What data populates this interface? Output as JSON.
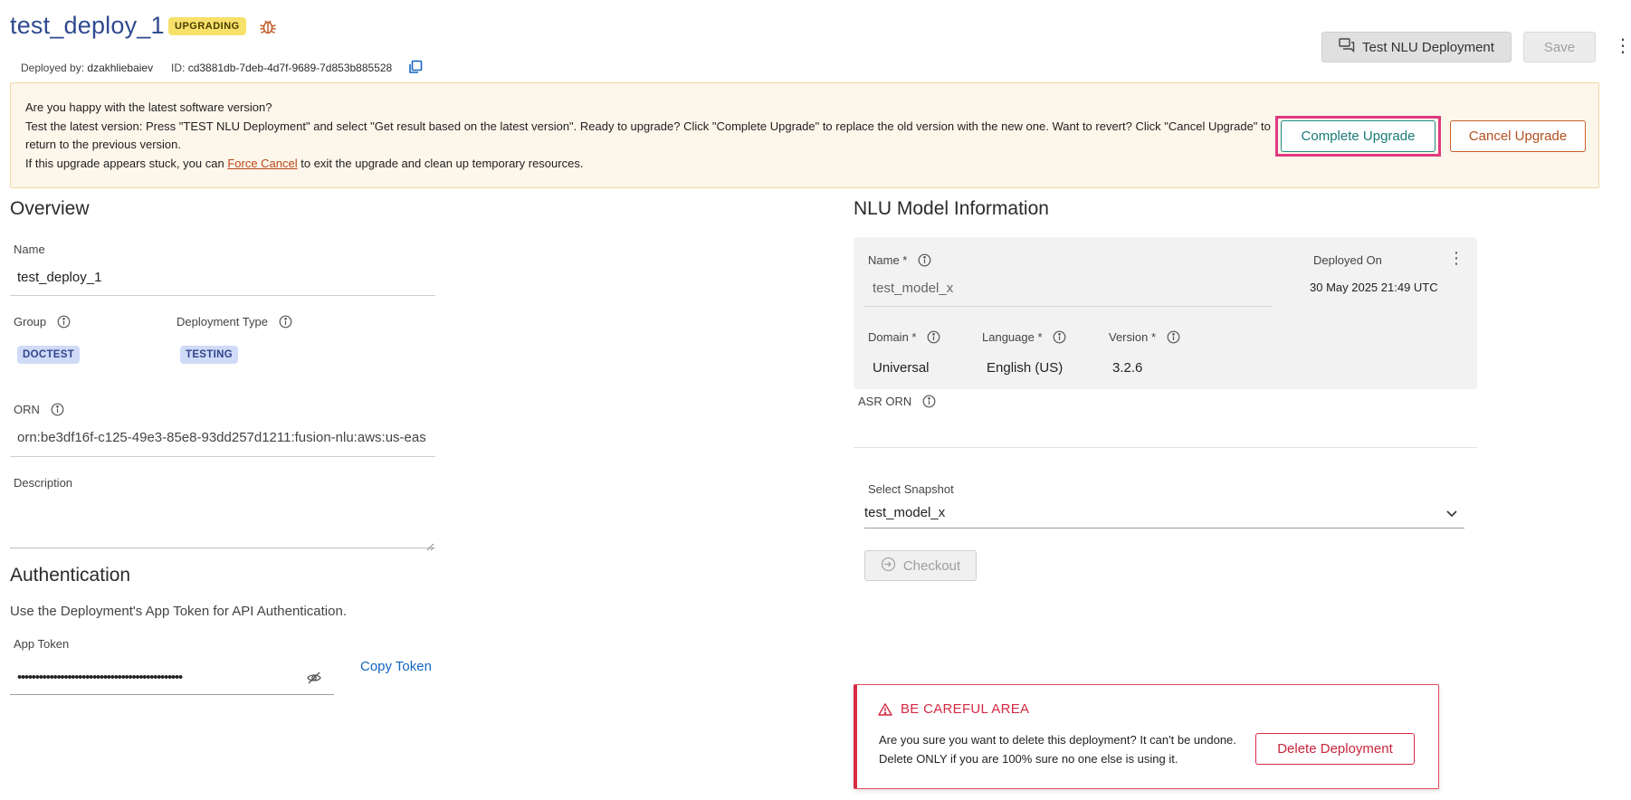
{
  "header": {
    "title": "test_deploy_1",
    "status_badge": "UPGRADING",
    "deployed_by_label": "Deployed by:",
    "deployed_by_value": "dzakhliebaiev",
    "id_label": "ID:",
    "id_value": "cd3881db-7deb-4d7f-9689-7d853b885528",
    "test_button": "Test NLU Deployment",
    "save_button": "Save"
  },
  "banner": {
    "question": "Are you happy with the latest software version?",
    "instructions": "Test the latest version: Press \"TEST NLU Deployment\" and select \"Get result based on the latest version\". Ready to upgrade? Click \"Complete Upgrade\" to replace the old version with the new one. Want to revert? Click \"Cancel Upgrade\" to return to the previous version.",
    "stuck_prefix": "If this upgrade appears stuck, you can",
    "force_cancel_link": "Force Cancel",
    "stuck_suffix": "to exit the upgrade and clean up temporary resources.",
    "complete_button": "Complete Upgrade",
    "cancel_button": "Cancel Upgrade"
  },
  "overview": {
    "heading": "Overview",
    "name_label": "Name",
    "name_value": "test_deploy_1",
    "group_label": "Group",
    "group_value": "DOCTEST",
    "deployment_type_label": "Deployment Type",
    "deployment_type_value": "TESTING",
    "orn_label": "ORN",
    "orn_value": "orn:be3df16f-c125-49e3-85e8-93dd257d1211:fusion-nlu:aws:us-eas",
    "description_label": "Description"
  },
  "authentication": {
    "heading": "Authentication",
    "subtitle": "Use the Deployment's App Token for API Authentication.",
    "token_label": "App Token",
    "token_masked": "••••••••••••••••••••••••••••••••••••••••••••••",
    "copy_token": "Copy Token"
  },
  "nlu": {
    "heading": "NLU Model Information",
    "name_label": "Name *",
    "name_value": "test_model_x",
    "deployed_on_label": "Deployed On",
    "deployed_on_value": "30 May 2025 21:49 UTC",
    "domain_label": "Domain *",
    "domain_value": "Universal",
    "language_label": "Language *",
    "language_value": "English (US)",
    "version_label": "Version *",
    "version_value": "3.2.6",
    "asr_orn_label": "ASR ORN",
    "select_snapshot_label": "Select Snapshot",
    "select_snapshot_value": "test_model_x",
    "checkout_button": "Checkout"
  },
  "careful": {
    "title": "BE CAREFUL AREA",
    "text": "Are you sure you want to delete this deployment? It can't be undone. Delete ONLY if you are 100% sure no one else is using it.",
    "delete_button": "Delete Deployment"
  },
  "colors": {
    "title": "#2f4a8f",
    "upgrading_badge": "#f7e16a",
    "banner_bg": "#fdf6ea",
    "complete_border": "#1e8a86",
    "highlight": "#e03a7f",
    "cancel_border": "#c9602a",
    "chip_bg": "#cfdbf7",
    "danger": "#d92b43",
    "link": "#1565c0"
  },
  "icons": [
    "bug-icon",
    "copy-icon",
    "chat-icon",
    "kebab-icon",
    "info-icon",
    "eye-off-icon",
    "chevron-down-icon",
    "checkout-icon",
    "warning-icon",
    "resize-handle-icon"
  ]
}
